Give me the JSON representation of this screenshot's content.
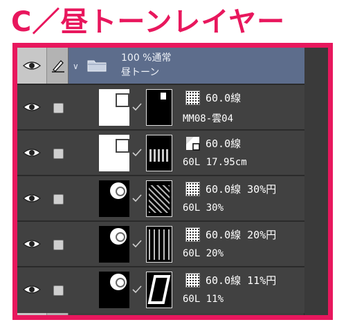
{
  "header": {
    "title": "C／昼トーンレイヤー"
  },
  "folder": {
    "opacity_blend": "100 %通常",
    "name": "昼トーン"
  },
  "layers": [
    {
      "line1": "60.0線",
      "line2": "MM08-雲04",
      "thumb": "gradient-checker",
      "mask": "dark-scene"
    },
    {
      "line1": "60.0線",
      "line2": "60L 17.95cm",
      "thumb": "gradient-checker",
      "mask": "interior-scene"
    },
    {
      "line1": "60.0線 30%円",
      "line2": "60L 30%",
      "thumb": "dot-black",
      "mask": "city-scene"
    },
    {
      "line1": "60.0線 20%円",
      "line2": "60L 20%",
      "thumb": "dot-black",
      "mask": "station-scene"
    },
    {
      "line1": "60.0線 11%円",
      "line2": "60L 11%",
      "thumb": "dot-black",
      "mask": "window-scene"
    }
  ],
  "colors": {
    "accent": "#e8175d",
    "folder_bg": "#5d6d8c",
    "panel_bg": "#414141"
  },
  "icons": {
    "visibility": "eye-icon",
    "lock": "checkbox",
    "folder": "folder-icon",
    "edit": "pen-icon",
    "tone": "halftone-icon",
    "mask": "mask-thumbnail"
  }
}
